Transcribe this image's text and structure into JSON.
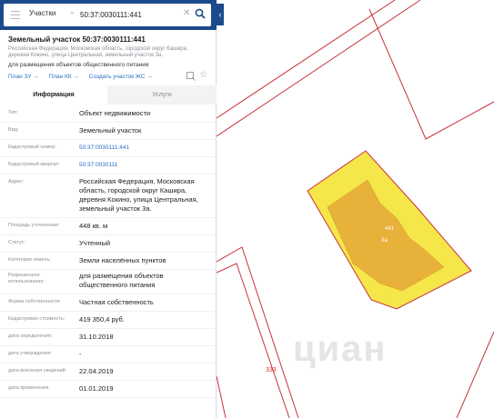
{
  "search": {
    "layer": "Участки",
    "query": "50:37:0030111:441"
  },
  "header": {
    "title": "Земельный участок 50:37:0030111:441",
    "address_short": "Российская Федерация, Московская область, городской округ Кашира, деревня Кокино, улица Центральная, земельный участок 3а.",
    "purpose": "для размещения объектов общественного питания"
  },
  "links": [
    "План ЗУ →",
    "План КК →",
    "Создать участок ЖС →"
  ],
  "tabs": {
    "info": "Информация",
    "services": "Услуги"
  },
  "rows": [
    {
      "key": "Тип:",
      "value": "Объект недвижимости"
    },
    {
      "key": "Вид:",
      "value": "Земельный участок"
    },
    {
      "key": "Кадастровый номер:",
      "value": "50:37:0030111:441"
    },
    {
      "key": "Кадастровый квартал:",
      "value": "50:37:0030111"
    },
    {
      "key": "Адрес:",
      "value": "Российская Федерация, Московская область, городской округ Кашира, деревня Кокино, улица Центральная, земельный участок 3а."
    },
    {
      "key": "Площадь уточненная:",
      "value": "448 кв. м"
    },
    {
      "key": "Статус:",
      "value": "Учтенный"
    },
    {
      "key": "Категория земель:",
      "value": "Земли населённых пунктов"
    },
    {
      "key": "Разрешенное использование:",
      "value": "для размещения объектов общественного питания"
    },
    {
      "key": "Форма собственности:",
      "value": "Частная собственность"
    },
    {
      "key": "Кадастровая стоимость:",
      "value": "419 350,4 руб."
    },
    {
      "key": "дата определения:",
      "value": "31.10.2018"
    },
    {
      "key": "дата утверждения:",
      "value": "-"
    },
    {
      "key": "дата внесения сведений:",
      "value": "22.04.2019"
    },
    {
      "key": "дата применения:",
      "value": "01.01.2019"
    }
  ],
  "map": {
    "parcel_label": "441",
    "parcel_sublabel": "3а",
    "neighbor_label": "333",
    "watermark": "циан"
  },
  "colors": {
    "header_bg": "#1c4b8b",
    "parcel_fill": "#f5e64a",
    "building_fill": "#e8b23a",
    "boundary": "#c8323c",
    "link": "#2a6fc1"
  }
}
